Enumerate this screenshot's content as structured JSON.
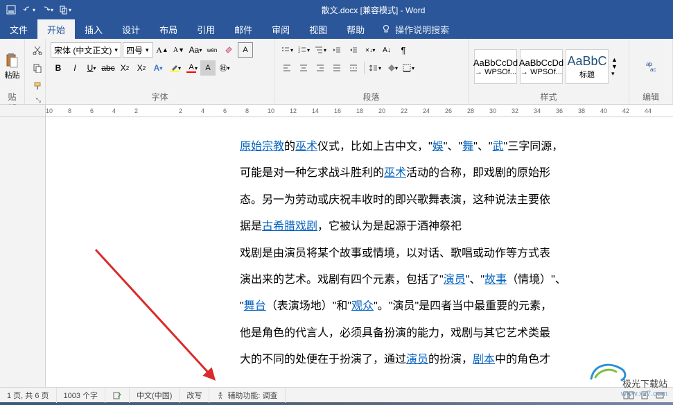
{
  "title": "散文.docx [兼容模式] - Word",
  "menu": {
    "file": "文件",
    "home": "开始",
    "insert": "插入",
    "design": "设计",
    "layout": "布局",
    "references": "引用",
    "mail": "邮件",
    "review": "审阅",
    "view": "视图",
    "help": "帮助",
    "search": "操作说明搜索"
  },
  "ribbon": {
    "clipboard_label": "剪贴板",
    "paste": "粘贴",
    "font_label": "字体",
    "font_name": "宋体 (中文正文)",
    "font_size": "四号",
    "para_label": "段落",
    "styles_label": "样式",
    "styles": [
      {
        "preview": "AaBbCcDd",
        "name": "→ WPSOf..."
      },
      {
        "preview": "AaBbCcDd",
        "name": "→ WPSOf..."
      },
      {
        "preview": "AaBbC",
        "name": "标题"
      }
    ],
    "edit_label": "编辑"
  },
  "ruler_ticks": [
    "10",
    "8",
    "6",
    "4",
    "2",
    "",
    "2",
    "4",
    "6",
    "8",
    "10",
    "12",
    "14",
    "16",
    "18",
    "20",
    "22",
    "24",
    "26",
    "28",
    "30",
    "32",
    "34",
    "36",
    "38",
    "40",
    "42",
    "44"
  ],
  "document": {
    "seg1a": "原始宗教",
    "seg1b": "的",
    "seg1c": "巫术",
    "seg1d": "仪式，比如上古中文，\"",
    "seg1e": "娛",
    "seg1f": "\"、\"",
    "seg1g": "舞",
    "seg1h": "\"、\"",
    "seg1i": "武",
    "seg1j": "\"三字同源，",
    "seg2a": "可能是对一种乞求战斗胜利的",
    "seg2b": "巫术",
    "seg2c": "活动的合称，即戏剧的原始形",
    "seg3": "态。另一为劳动或庆祝丰收时的即兴歌舞表演，这种说法主要依",
    "seg4a": "据是",
    "seg4b": "古希腊戏剧",
    "seg4c": "，它被认为是起源于酒神祭祀",
    "seg5": "戏剧是由演员将某个故事或情境，以对话、歌唱或动作等方式表",
    "seg6a": "演出来的艺术。戏剧有四个元素，包括了\"",
    "seg6b": "演员",
    "seg6c": "\"、\"",
    "seg6d": "故事",
    "seg6e": "（情境）\"、",
    "seg7a": "\"",
    "seg7b": "舞台",
    "seg7c": "（表演场地）\"和\"",
    "seg7d": "观众",
    "seg7e": "\"。\"演员\"是四者当中最重要的元素，",
    "seg8": "他是角色的代言人，必须具备扮演的能力，戏剧与其它艺术类最",
    "seg9a": "大的不同的处便在于扮演了，通过",
    "seg9b": "演员",
    "seg9c": "的扮演，",
    "seg9d": "剧本",
    "seg9e": "中的角色才"
  },
  "status": {
    "page": "1 页, 共 6 页",
    "words": "1003 个字",
    "lang": "中文(中国)",
    "overtype": "改写",
    "accessibility": "辅助功能: 调查"
  },
  "watermark": {
    "brand": "极光下载站",
    "url": "www.xz7.com"
  }
}
